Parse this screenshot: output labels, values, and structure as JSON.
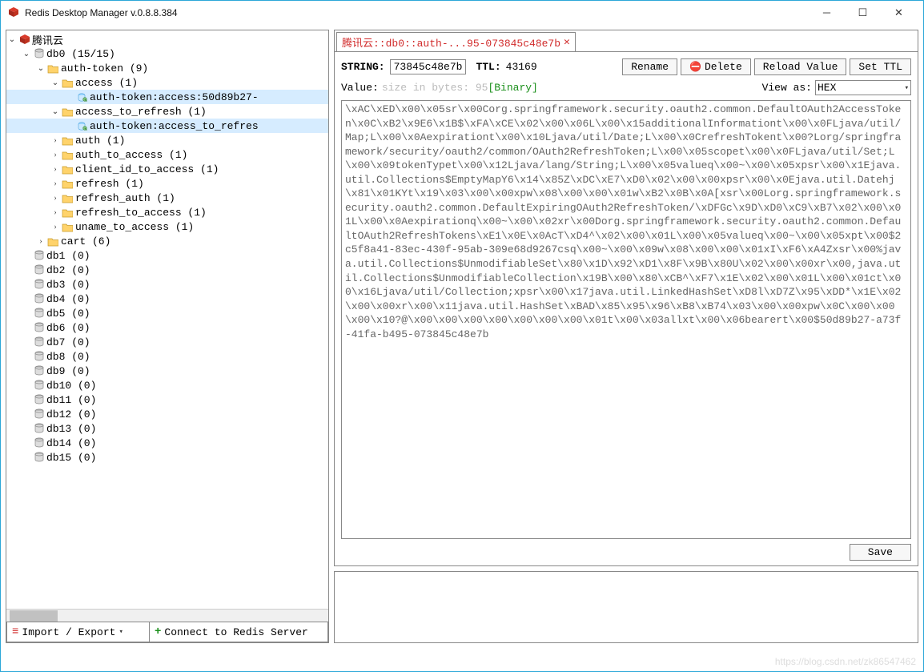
{
  "window": {
    "title": "Redis Desktop Manager v.0.8.8.384"
  },
  "buttons": {
    "import_export": "Import / Export",
    "connect": "Connect to Redis Server",
    "rename": "Rename",
    "delete": "Delete",
    "reload_value": "Reload Value",
    "set_ttl": "Set TTL",
    "save": "Save"
  },
  "tab": {
    "label": "腾讯云::db0::auth-...95-073845c48e7b"
  },
  "key": {
    "type": "STRING:",
    "name": "73845c48e7b",
    "ttl_label": "TTL:",
    "ttl_value": "43169"
  },
  "value_meta": {
    "label": "Value:",
    "hint": "size in bytes: 95",
    "binary_tag": "[Binary]",
    "view_as_label": "View as:",
    "view_as_value": "HEX"
  },
  "value_body": "\\xAC\\xED\\x00\\x05sr\\x00Corg.springframework.security.oauth2.common.DefaultOAuth2AccessToken\\x0C\\xB2\\x9E6\\x1B$\\xFA\\xCE\\x02\\x00\\x06L\\x00\\x15additionalInformationt\\x00\\x0FLjava/util/Map;L\\x00\\x0Aexpirationt\\x00\\x10Ljava/util/Date;L\\x00\\x0CrefreshTokent\\x00?Lorg/springframework/security/oauth2/common/OAuth2RefreshToken;L\\x00\\x05scopet\\x00\\x0FLjava/util/Set;L\\x00\\x09tokenTypet\\x00\\x12Ljava/lang/String;L\\x00\\x05valueq\\x00~\\x00\\x05xpsr\\x00\\x1Ejava.util.Collections$EmptyMapY6\\x14\\x85Z\\xDC\\xE7\\xD0\\x02\\x00\\x00xpsr\\x00\\x0Ejava.util.Datehj\\x81\\x01KYt\\x19\\x03\\x00\\x00xpw\\x08\\x00\\x00\\x01w\\xB2\\x0B\\x0A[xsr\\x00Lorg.springframework.security.oauth2.common.DefaultExpiringOAuth2RefreshToken/\\xDFGc\\x9D\\xD0\\xC9\\xB7\\x02\\x00\\x01L\\x00\\x0Aexpirationq\\x00~\\x00\\x02xr\\x00Dorg.springframework.security.oauth2.common.DefaultOAuth2RefreshTokens\\xE1\\x0E\\x0AcT\\xD4^\\x02\\x00\\x01L\\x00\\x05valueq\\x00~\\x00\\x05xpt\\x00$2c5f8a41-83ec-430f-95ab-309e68d9267csq\\x00~\\x00\\x09w\\x08\\x00\\x00\\x01xI\\xF6\\xA4Zxsr\\x00%java.util.Collections$UnmodifiableSet\\x80\\x1D\\x92\\xD1\\x8F\\x9B\\x80U\\x02\\x00\\x00xr\\x00,java.util.Collections$UnmodifiableCollection\\x19B\\x00\\x80\\xCB^\\xF7\\x1E\\x02\\x00\\x01L\\x00\\x01ct\\x00\\x16Ljava/util/Collection;xpsr\\x00\\x17java.util.LinkedHashSet\\xD8l\\xD7Z\\x95\\xDD*\\x1E\\x02\\x00\\x00xr\\x00\\x11java.util.HashSet\\xBAD\\x85\\x95\\x96\\xB8\\xB74\\x03\\x00\\x00xpw\\x0C\\x00\\x00\\x00\\x10?@\\x00\\x00\\x00\\x00\\x00\\x00\\x00\\x01t\\x00\\x03allxt\\x00\\x06bearert\\x00$50d89b27-a73f-41fa-b495-073845c48e7b",
  "tree": {
    "connection": "腾讯云",
    "db0": {
      "label": "db0",
      "count": "(15/15)"
    },
    "auth_token": {
      "label": "auth-token",
      "count": "(9)"
    },
    "access": {
      "label": "access",
      "count": "(1)"
    },
    "access_key": "auth-token:access:50d89b27-",
    "access_to_refresh": {
      "label": "access_to_refresh",
      "count": "(1)"
    },
    "access_to_refresh_key": "auth-token:access_to_refres",
    "auth": {
      "label": "auth",
      "count": "(1)"
    },
    "auth_to_access": {
      "label": "auth_to_access",
      "count": "(1)"
    },
    "client_id_to_access": {
      "label": "client_id_to_access",
      "count": "(1)"
    },
    "refresh": {
      "label": "refresh",
      "count": "(1)"
    },
    "refresh_auth": {
      "label": "refresh_auth",
      "count": "(1)"
    },
    "refresh_to_access": {
      "label": "refresh_to_access",
      "count": "(1)"
    },
    "uname_to_access": {
      "label": "uname_to_access",
      "count": "(1)"
    },
    "cart": {
      "label": "cart",
      "count": "(6)"
    },
    "dbs": [
      {
        "label": "db1",
        "count": "(0)"
      },
      {
        "label": "db2",
        "count": "(0)"
      },
      {
        "label": "db3",
        "count": "(0)"
      },
      {
        "label": "db4",
        "count": "(0)"
      },
      {
        "label": "db5",
        "count": "(0)"
      },
      {
        "label": "db6",
        "count": "(0)"
      },
      {
        "label": "db7",
        "count": "(0)"
      },
      {
        "label": "db8",
        "count": "(0)"
      },
      {
        "label": "db9",
        "count": "(0)"
      },
      {
        "label": "db10",
        "count": "(0)"
      },
      {
        "label": "db11",
        "count": "(0)"
      },
      {
        "label": "db12",
        "count": "(0)"
      },
      {
        "label": "db13",
        "count": "(0)"
      },
      {
        "label": "db14",
        "count": "(0)"
      },
      {
        "label": "db15",
        "count": "(0)"
      }
    ]
  },
  "watermark": "https://blog.csdn.net/zk86547462"
}
